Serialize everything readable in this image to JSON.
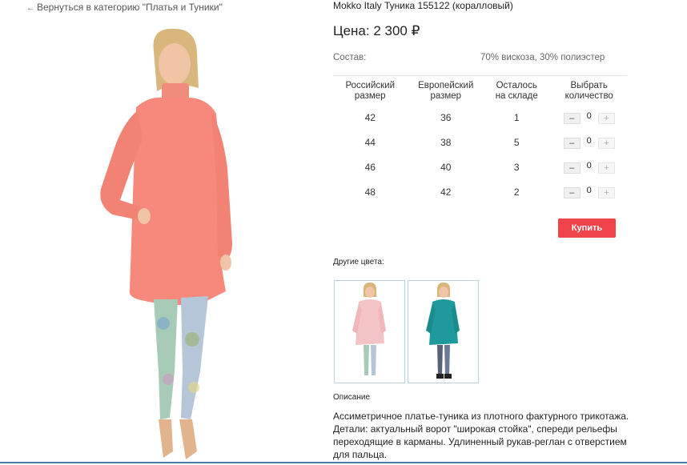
{
  "nav": {
    "back_label": "Вернуться в категорию \"Платья и Туники\""
  },
  "product": {
    "title": "Mokko Italy Туника 155122 (коралловый)",
    "price_label": "Цена: 2 300",
    "currency": "₽",
    "composition_label": "Состав:",
    "composition_value": "70% вискоза, 30% полиэстер"
  },
  "size_table": {
    "headers": {
      "ru_size": [
        "Российский",
        "размер"
      ],
      "eu_size": [
        "Европейский",
        "размер"
      ],
      "stock": [
        "Осталось",
        "на складе"
      ],
      "qty": [
        "Выбрать",
        "количество"
      ]
    },
    "rows": [
      {
        "ru": "42",
        "eu": "36",
        "stock": "1",
        "qty": "0"
      },
      {
        "ru": "44",
        "eu": "38",
        "stock": "5",
        "qty": "0"
      },
      {
        "ru": "46",
        "eu": "40",
        "stock": "3",
        "qty": "0"
      },
      {
        "ru": "48",
        "eu": "42",
        "stock": "2",
        "qty": "0"
      }
    ],
    "minus": "–",
    "plus": "+"
  },
  "buy_label": "Купить",
  "other_colors_label": "Другие цвета:",
  "description_label": "Описание",
  "description_text": "Ассиметричное платье-туника из плотного фактурного трикотажа. Детали: актуальный ворот \"широкая стойка\", спереди рельефы переходящие в карманы. Удлиненный рукав-реглан с отверстием для пальца.",
  "colors": {
    "accent": "#f0434a",
    "coral": "#f6897b",
    "pink": "#f4c3c6",
    "teal": "#1f9a9c"
  }
}
